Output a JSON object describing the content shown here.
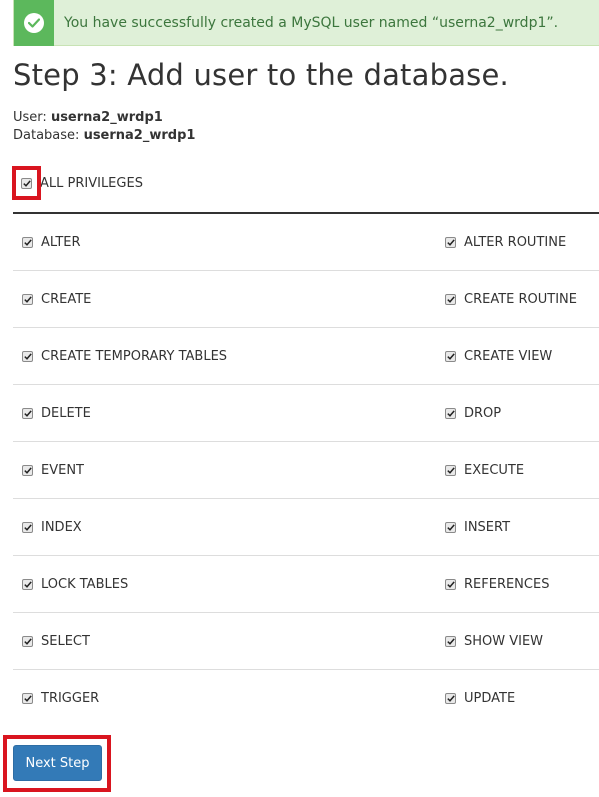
{
  "alert": {
    "icon": "check-circle-icon",
    "message": "You have successfully created a MySQL user named “userna2_wrdp1”.",
    "colors": {
      "background": "#dff0d8",
      "icon_bg": "#5cb85c",
      "text": "#3c763d"
    }
  },
  "page": {
    "title": "Step 3: Add user to the database."
  },
  "meta": {
    "user_label": "User:",
    "user_value": "userna2_wrdp1",
    "database_label": "Database:",
    "database_value": "userna2_wrdp1"
  },
  "all_privileges": {
    "label": "ALL PRIVILEGES",
    "checked": true
  },
  "privileges": [
    [
      {
        "label": "ALTER",
        "checked": true
      },
      {
        "label": "ALTER ROUTINE",
        "checked": true
      }
    ],
    [
      {
        "label": "CREATE",
        "checked": true
      },
      {
        "label": "CREATE ROUTINE",
        "checked": true
      }
    ],
    [
      {
        "label": "CREATE TEMPORARY TABLES",
        "checked": true
      },
      {
        "label": "CREATE VIEW",
        "checked": true
      }
    ],
    [
      {
        "label": "DELETE",
        "checked": true
      },
      {
        "label": "DROP",
        "checked": true
      }
    ],
    [
      {
        "label": "EVENT",
        "checked": true
      },
      {
        "label": "EXECUTE",
        "checked": true
      }
    ],
    [
      {
        "label": "INDEX",
        "checked": true
      },
      {
        "label": "INSERT",
        "checked": true
      }
    ],
    [
      {
        "label": "LOCK TABLES",
        "checked": true
      },
      {
        "label": "REFERENCES",
        "checked": true
      }
    ],
    [
      {
        "label": "SELECT",
        "checked": true
      },
      {
        "label": "SHOW VIEW",
        "checked": true
      }
    ],
    [
      {
        "label": "TRIGGER",
        "checked": true
      },
      {
        "label": "UPDATE",
        "checked": true
      }
    ]
  ],
  "next_button": {
    "label": "Next Step",
    "color": "#337ab7"
  },
  "highlight_color": "#d9151f"
}
